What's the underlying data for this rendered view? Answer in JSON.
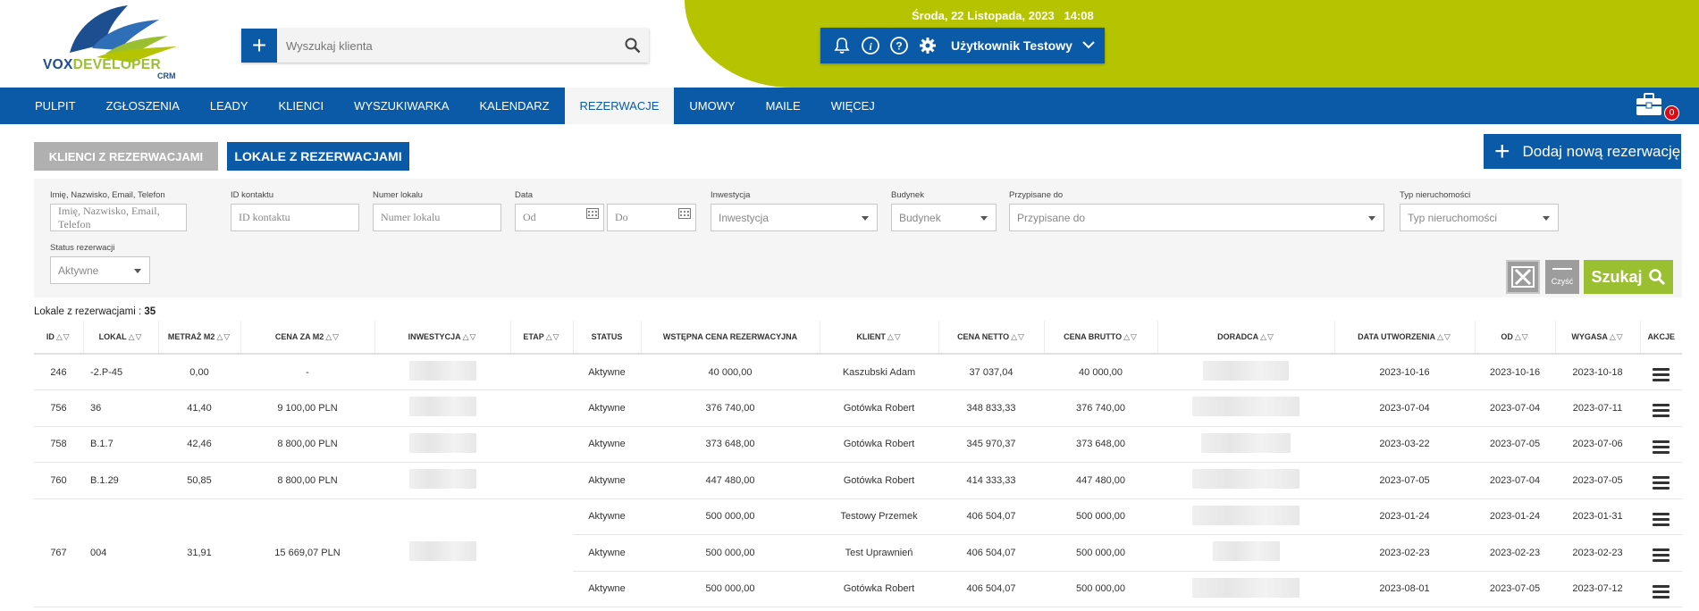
{
  "header": {
    "datetime": "Środa, 22 Listopada, 2023   14:08",
    "search_placeholder": "Wyszukaj klienta",
    "user_name": "Użytkownik Testowy",
    "logo_text_a": "VOX",
    "logo_text_b": "DEVELOPER",
    "logo_crm": "CRM"
  },
  "nav": {
    "items": [
      "PULPIT",
      "ZGŁOSZENIA",
      "LEADY",
      "KLIENCI",
      "WYSZUKIWARKA",
      "KALENDARZ",
      "REZERWACJE",
      "UMOWY",
      "MAILE",
      "WIĘCEJ"
    ],
    "active": "REZERWACJE",
    "briefcase_count": "0"
  },
  "tabs": {
    "clients": "KLIENCI Z REZERWACJAMI",
    "units": "LOKALE Z REZERWACJAMI"
  },
  "add_button": "Dodaj nową rezerwację",
  "filters": {
    "name": {
      "label": "Imię, Nazwisko, Email, Telefon",
      "placeholder": "Imię, Nazwisko, Email, Telefon"
    },
    "contact_id": {
      "label": "ID kontaktu",
      "placeholder": "ID kontaktu"
    },
    "unit_number": {
      "label": "Numer lokalu",
      "placeholder": "Numer lokalu"
    },
    "date": {
      "label": "Data",
      "from": "Od",
      "to": "Do"
    },
    "investment": {
      "label": "Inwestycja",
      "value": "Inwestycja"
    },
    "building": {
      "label": "Budynek",
      "value": "Budynek"
    },
    "assigned": {
      "label": "Przypisane do",
      "value": "Przypisane do"
    },
    "property_type": {
      "label": "Typ nieruchomości",
      "value": "Typ nieruchomości"
    },
    "status": {
      "label": "Status rezerwacji",
      "value": "Aktywne"
    }
  },
  "buttons": {
    "clear_label": "Czyść",
    "search_label": "Szukaj"
  },
  "count": {
    "label": "Lokale z rezerwacjami :",
    "value": "35"
  },
  "table": {
    "headers": [
      "ID",
      "LOKAL",
      "METRAŻ M2",
      "CENA ZA M2",
      "INWESTYCJA",
      "ETAP",
      "STATUS",
      "WSTĘPNA CENA REZERWACYJNA",
      "KLIENT",
      "CENA NETTO",
      "CENA BRUTTO",
      "DORADCA",
      "DATA UTWORZENIA",
      "OD",
      "WYGASA",
      "AKCJE"
    ],
    "rows": [
      {
        "id": "246",
        "unit": "-2.P-45",
        "area": "0,00",
        "price_m2": "-",
        "status": "Aktywne",
        "initial_price": "40 000,00",
        "client": "Kaszubski Adam",
        "net": "37 037,04",
        "gross": "40 000,00",
        "created": "2023-10-16",
        "from": "2023-10-16",
        "expires": "2023-10-18"
      },
      {
        "id": "756",
        "unit": "36",
        "area": "41,40",
        "price_m2": "9 100,00 PLN",
        "status": "Aktywne",
        "initial_price": "376 740,00",
        "client": "Gotówka Robert",
        "net": "348 833,33",
        "gross": "376 740,00",
        "created": "2023-07-04",
        "from": "2023-07-04",
        "expires": "2023-07-11"
      },
      {
        "id": "758",
        "unit": "B.1.7",
        "area": "42,46",
        "price_m2": "8 800,00 PLN",
        "status": "Aktywne",
        "initial_price": "373 648,00",
        "client": "Gotówka Robert",
        "net": "345 970,37",
        "gross": "373 648,00",
        "created": "2023-03-22",
        "from": "2023-07-05",
        "expires": "2023-07-06"
      },
      {
        "id": "760",
        "unit": "B.1.29",
        "area": "50,85",
        "price_m2": "8 800,00 PLN",
        "status": "Aktywne",
        "initial_price": "447 480,00",
        "client": "Gotówka Robert",
        "net": "414 333,33",
        "gross": "447 480,00",
        "created": "2023-07-05",
        "from": "2023-07-04",
        "expires": "2023-07-05"
      }
    ],
    "group": {
      "id": "767",
      "unit": "004",
      "area": "31,91",
      "price_m2": "15 669,07 PLN",
      "rows": [
        {
          "status": "Aktywne",
          "initial_price": "500 000,00",
          "client": "Testowy Przemek",
          "net": "406 504,07",
          "gross": "500 000,00",
          "created": "2023-01-24",
          "from": "2023-01-24",
          "expires": "2023-01-31"
        },
        {
          "status": "Aktywne",
          "initial_price": "500 000,00",
          "client": "Test Uprawnień",
          "net": "406 504,07",
          "gross": "500 000,00",
          "created": "2023-02-23",
          "from": "2023-02-23",
          "expires": "2023-02-23"
        },
        {
          "status": "Aktywne",
          "initial_price": "500 000,00",
          "client": "Gotówka Robert",
          "net": "406 504,07",
          "gross": "500 000,00",
          "created": "2023-08-01",
          "from": "2023-07-05",
          "expires": "2023-07-12"
        }
      ]
    }
  },
  "colors": {
    "brand_blue": "#0b5aa8",
    "brand_green": "#b5c300",
    "search_green": "#9ac031",
    "badge_red": "#e30613"
  },
  "icons": [
    "plus-icon",
    "search-icon",
    "bell-icon",
    "info-icon",
    "help-icon",
    "gear-icon",
    "chevron-down-icon",
    "briefcase-icon",
    "calendar-icon",
    "close-x-icon",
    "hamburger-menu-icon",
    "sort-arrows-icon"
  ]
}
